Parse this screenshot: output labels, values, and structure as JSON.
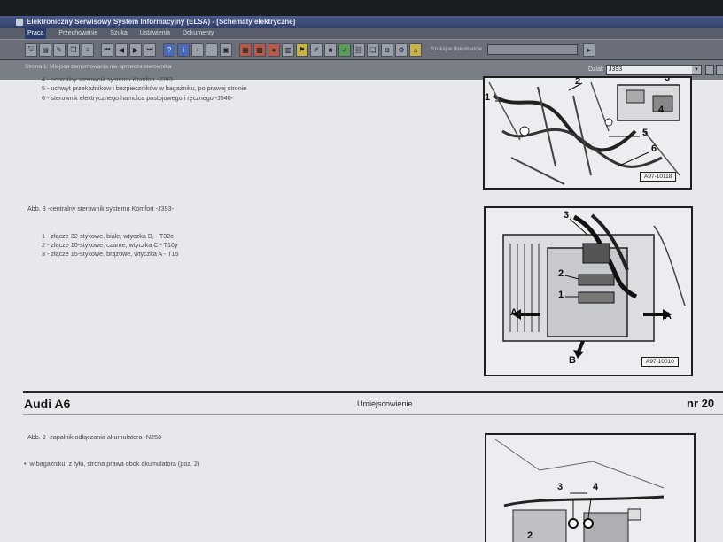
{
  "window": {
    "title": "Elektroniczny Serwisowy System Informacyjny (ELSA) - [Schematy elektryczne]"
  },
  "menu": [
    "Praca",
    "Przechowanie",
    "Szuka",
    "Ustawienia",
    "Dokumenty"
  ],
  "toolbar": {
    "search_label": "Szukaj w dokumencie",
    "buttons": [
      "exit",
      "print",
      "edit",
      "copy",
      "notes",
      "first",
      "prev",
      "next",
      "last",
      "help",
      "info",
      "zoom-in",
      "zoom-out",
      "view",
      "mark",
      "highlight",
      "note",
      "layers",
      "pen",
      "flag",
      "check",
      "link",
      "book",
      "disk",
      "settings",
      "home"
    ]
  },
  "filter": {
    "text": "Strona 1: Miejsca zamontowania nie-sprzecza sterownika",
    "dropdown_label": "Dzial:",
    "dropdown_value": "J393"
  },
  "doc": {
    "top_lines": [
      "4 - centralny sterownik systemu Komfort -J393-",
      "5 - uchwyt przekaźników i bezpieczników w bagażniku, po prawej stronie",
      "6 - sterownik elektrycznego hamulca postojowego i ręcznego -J540-"
    ],
    "fig1": {
      "ref": "A97-10118",
      "callouts": [
        "1",
        "2",
        "3",
        "4",
        "5",
        "6"
      ]
    },
    "abb8": {
      "title": "Abb. 8 -centralny sterownik systemu Komfort -J393-",
      "items": [
        "1 - złącze 32-stykowe, białe, wtyczka B, - T32c",
        "2 - złącze 10-stykowe, czarne, wtyczka C - T10y",
        "3 - złącze 15-stykowe, brązowe, wtyczka A - T15"
      ]
    },
    "fig2": {
      "ref": "A97-10010",
      "callouts": [
        "3",
        "2",
        "1",
        "A",
        "A",
        "B"
      ]
    },
    "header": {
      "left": "Audi A6",
      "center": "Umiejscowienie",
      "right": "nr 20"
    },
    "abb9": {
      "title": "Abb. 9 -zapalnik odłączania akumulatora -N253-",
      "bullet": "w bagażniku, z tyłu, strona prawa obok akumulatora (poz. 2)"
    },
    "fig3": {
      "callouts": [
        "3",
        "4",
        "2"
      ]
    }
  }
}
